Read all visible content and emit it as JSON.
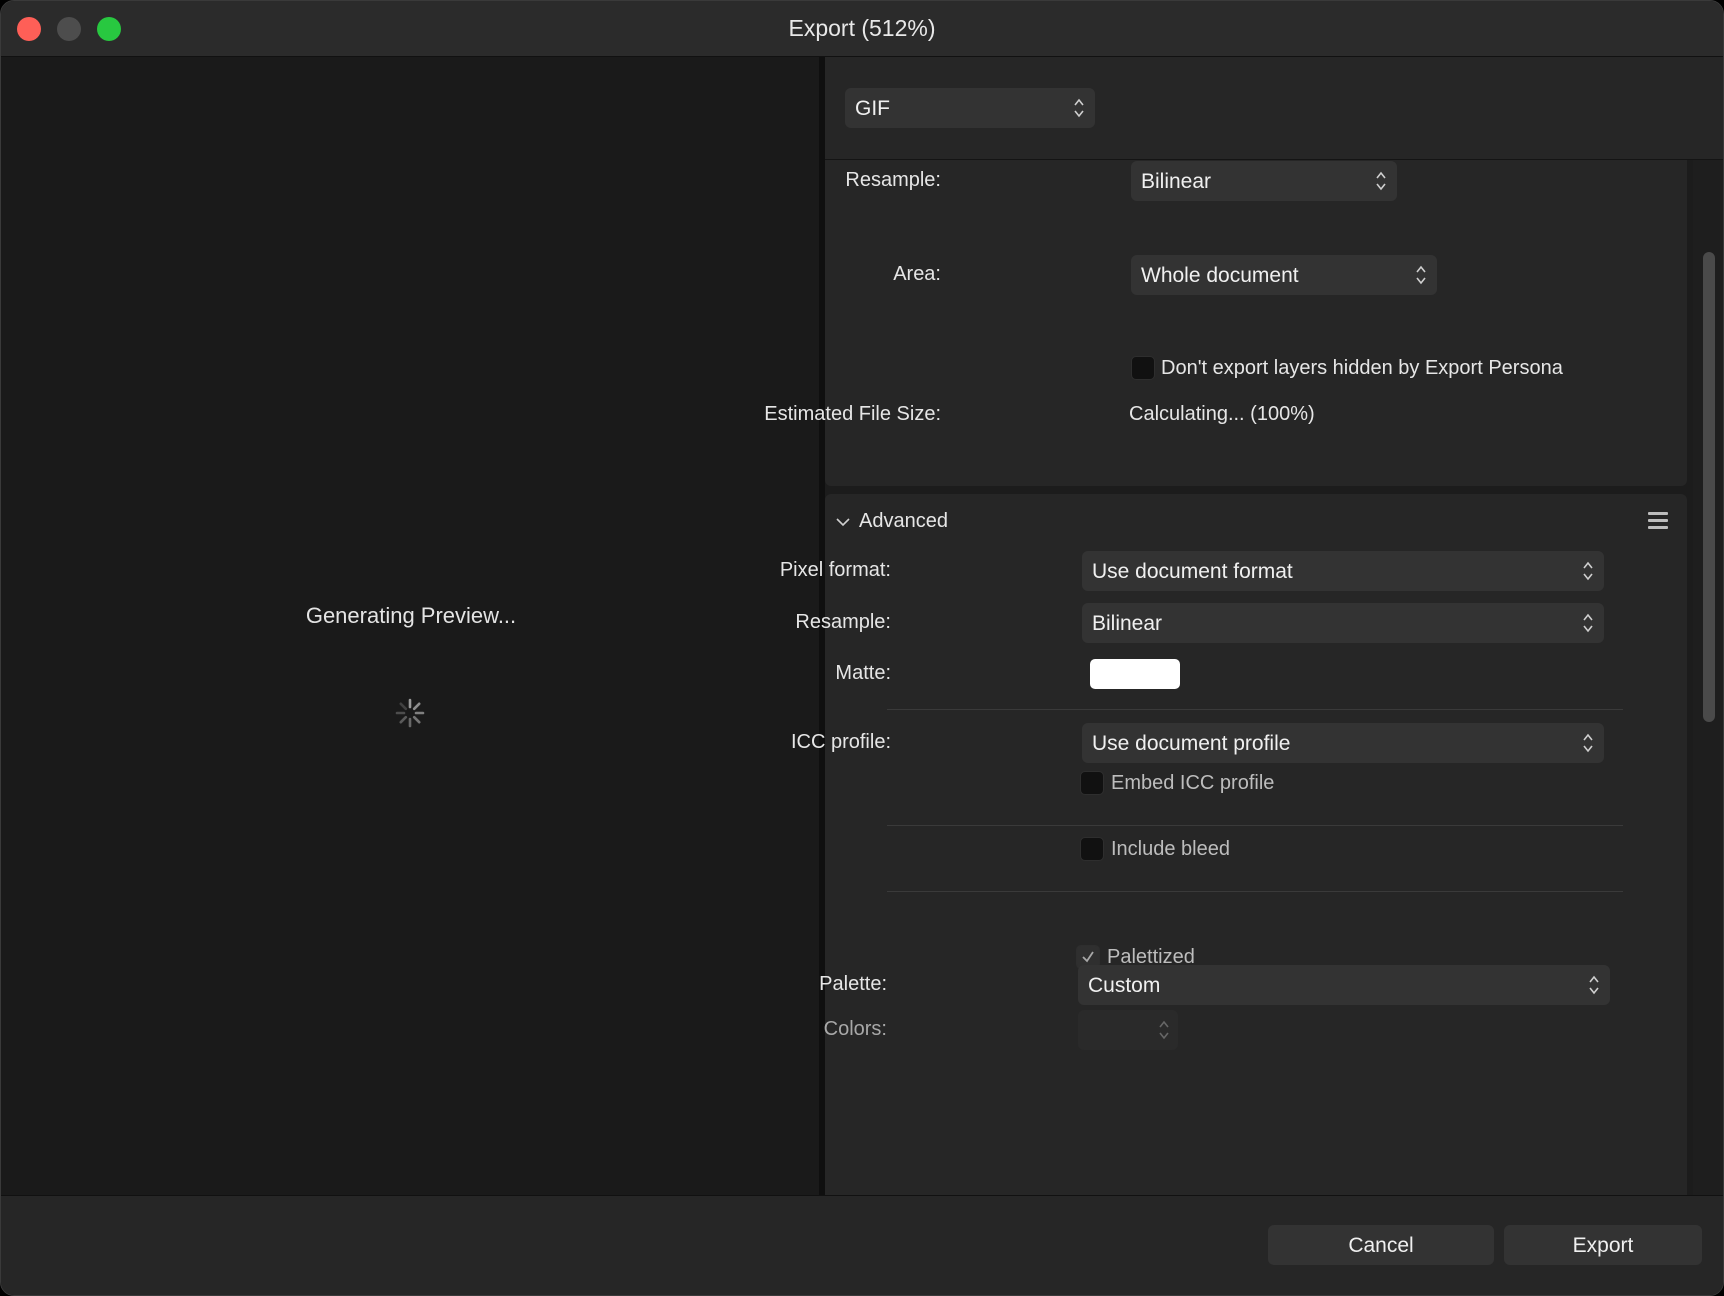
{
  "window": {
    "title": "Export (512%)"
  },
  "preview": {
    "status_text": "Generating Preview..."
  },
  "format": {
    "selected": "GIF"
  },
  "general": {
    "resample_label": "Resample:",
    "resample_value": "Bilinear",
    "area_label": "Area:",
    "area_value": "Whole document",
    "hidden_layers_label": "Don't export layers hidden by Export Persona",
    "filesize_label": "Estimated File Size:",
    "filesize_value": "Calculating... (100%)"
  },
  "advanced": {
    "title": "Advanced",
    "pixel_format_label": "Pixel format:",
    "pixel_format_value": "Use document format",
    "resample_label": "Resample:",
    "resample_value": "Bilinear",
    "matte_label": "Matte:",
    "matte_color": "#ffffff",
    "icc_label": "ICC profile:",
    "icc_value": "Use document profile",
    "embed_icc_label": "Embed ICC profile",
    "include_bleed_label": "Include bleed",
    "palettized_label": "Palettized",
    "palettized_checked": true,
    "palette_label": "Palette:",
    "palette_value": "Custom",
    "colors_label": "Colors:"
  },
  "footer": {
    "cancel_label": "Cancel",
    "export_label": "Export"
  },
  "colors": {
    "close": "#fe5f57",
    "minimize": "#4d4d4d",
    "maximize": "#28c840"
  },
  "icons": [
    "spinner-icon",
    "chevron-down-icon",
    "menu-icon",
    "up-down-arrows-icon",
    "checkmark-icon"
  ]
}
